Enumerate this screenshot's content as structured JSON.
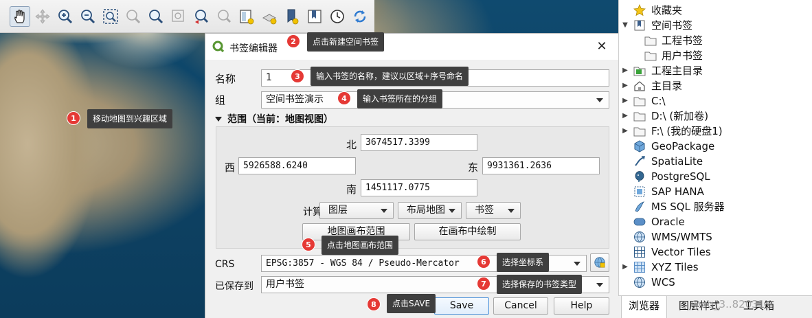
{
  "dialog": {
    "title": "书签编辑器",
    "name_label": "名称",
    "name_value": "1",
    "group_label": "组",
    "group_value": "空间书签演示",
    "extent_header": "范围（当前：地图视图）",
    "north_label": "北",
    "north_value": "3674517.3399",
    "west_label": "西",
    "west_value": "5926588.6240",
    "east_label": "东",
    "east_value": "9931361.2636",
    "south_label": "南",
    "south_value": "1451117.0775",
    "calc_from_label": "计算从",
    "layer_btn": "图层",
    "layout_map_btn": "布局地图",
    "bookmark_btn": "书签",
    "map_canvas_extent_btn": "地图画布范围",
    "draw_on_canvas_btn": "在画布中绘制",
    "crs_label": "CRS",
    "crs_value": "EPSG:3857 - WGS 84 / Pseudo-Mercator",
    "saved_to_label": "已保存到",
    "saved_to_value": "用户书签",
    "save_btn": "Save",
    "cancel_btn": "Cancel",
    "help_btn": "Help"
  },
  "annotations": [
    {
      "num": "1",
      "text": "移动地图到兴趣区域"
    },
    {
      "num": "2",
      "text": "点击新建空间书签"
    },
    {
      "num": "3",
      "text": "输入书签的名称，建议以区域+序号命名"
    },
    {
      "num": "4",
      "text": "输入书签所在的分组"
    },
    {
      "num": "5",
      "text": "点击地图画布范围"
    },
    {
      "num": "6",
      "text": "选择坐标系"
    },
    {
      "num": "7",
      "text": "选择保存的书签类型"
    },
    {
      "num": "8",
      "text": "点击SAVE"
    }
  ],
  "browser": {
    "items": [
      {
        "label": "收藏夹",
        "icon": "star-icon"
      },
      {
        "label": "空间书签",
        "icon": "bookmark-icon"
      },
      {
        "label": "工程书签",
        "icon": "folder-icon"
      },
      {
        "label": "用户书签",
        "icon": "folder-icon"
      },
      {
        "label": "工程主目录",
        "icon": "project-home-icon"
      },
      {
        "label": "主目录",
        "icon": "home-icon"
      },
      {
        "label": "C:\\",
        "icon": "folder-icon"
      },
      {
        "label": "D:\\ (新加卷)",
        "icon": "folder-icon"
      },
      {
        "label": "F:\\ (我的硬盘1)",
        "icon": "folder-icon"
      },
      {
        "label": "GeoPackage",
        "icon": "geopackage-icon"
      },
      {
        "label": "SpatiaLite",
        "icon": "spatialite-icon"
      },
      {
        "label": "PostgreSQL",
        "icon": "postgresql-icon"
      },
      {
        "label": "SAP HANA",
        "icon": "sap-hana-icon"
      },
      {
        "label": "MS SQL 服务器",
        "icon": "mssql-icon"
      },
      {
        "label": "Oracle",
        "icon": "oracle-icon"
      },
      {
        "label": "WMS/WMTS",
        "icon": "wms-icon"
      },
      {
        "label": "Vector Tiles",
        "icon": "vector-tiles-icon"
      },
      {
        "label": "XYZ Tiles",
        "icon": "xyz-tiles-icon"
      },
      {
        "label": "WCS",
        "icon": "wcs-icon"
      }
    ],
    "tabs": [
      "浏览器",
      "图层样式",
      "工具箱"
    ],
    "watermark": "@qq_3..82031"
  },
  "colors": {
    "callout_bg": "#3f3f3f",
    "number_badge": "#e53935",
    "qgis_green": "#589632"
  }
}
